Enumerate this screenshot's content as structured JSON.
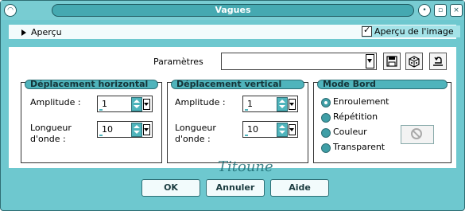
{
  "window": {
    "title": "Vagues"
  },
  "preview": {
    "label": "Aperçu",
    "image_preview_label": "Aperçu de l'image",
    "image_preview_checked": true
  },
  "params": {
    "label": "Paramètres",
    "value": ""
  },
  "groups": {
    "horizontal": {
      "title": "Déplacement horizontal",
      "amplitude_label": "Amplitude :",
      "amplitude": "1",
      "wavelength_label": "Longueur\nd'onde :",
      "wavelength": "10"
    },
    "vertical": {
      "title": "Déplacement vertical",
      "amplitude_label": "Amplitude :",
      "amplitude": "1",
      "wavelength_label": "Longueur\nd'onde :",
      "wavelength": "10"
    },
    "edge": {
      "title": "Mode Bord",
      "options": [
        "Enroulement",
        "Répétition",
        "Couleur",
        "Transparent"
      ],
      "selected": "Enroulement"
    }
  },
  "buttons": {
    "ok": "OK",
    "cancel": "Annuler",
    "help": "Aide"
  },
  "signature": "Titoune",
  "colors": {
    "accent": "#6ec8cf",
    "accent_dark": "#4fb4bc"
  }
}
